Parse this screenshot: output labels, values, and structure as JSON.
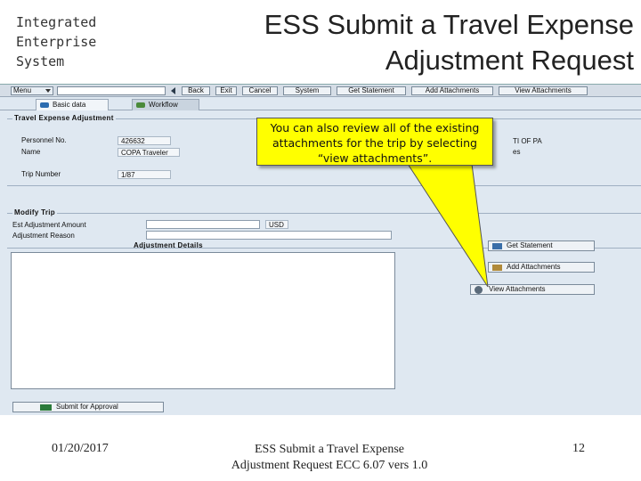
{
  "header": {
    "ies_lines": [
      "Integrated",
      "Enterprise",
      "System"
    ],
    "title_line1": "ESS Submit a Travel Expense",
    "title_line2": "Adjustment Request"
  },
  "toolbar": {
    "command_label": "Menu",
    "buttons": [
      "Back",
      "Exit",
      "Cancel",
      "System",
      "Get Statement",
      "Add Attachments",
      "View Attachments"
    ]
  },
  "tabs": [
    {
      "label": "Basic data",
      "active": true
    },
    {
      "label": "Workflow",
      "active": false
    }
  ],
  "travel_expense_adjustment": {
    "title": "Travel Expense Adjustment",
    "personnel_no_label": "Personnel No.",
    "personnel_no_value": "426632",
    "name_label": "Name",
    "name_value": "COPA Traveler",
    "trip_number_label": "Trip Number",
    "trip_number_value": "1/87",
    "partial_org_text": "TI OF PA",
    "partial_text2": "es"
  },
  "modify_trip": {
    "title": "Modify Trip",
    "est_adjustment_label": "Est Adjustment Amount",
    "currency": "USD",
    "adjustment_reason_label": "Adjustment Reason",
    "adjustment_details_label": "Adjustment Details"
  },
  "side_buttons": [
    "Get Statement",
    "Add Attachments",
    "View Attachments"
  ],
  "submit_label": "Submit for Approval",
  "callout": {
    "line1": "You can also review all of the existing",
    "line2": "attachments for the trip by selecting",
    "line3": "“view attachments”."
  },
  "footer": {
    "date": "01/20/2017",
    "center_line1": "ESS Submit a Travel Expense",
    "center_line2": "Adjustment Request ECC 6.07 vers 1.0",
    "page": "12"
  },
  "colors": {
    "callout": "#ffff00",
    "sap_background": "#dfe8f1"
  }
}
